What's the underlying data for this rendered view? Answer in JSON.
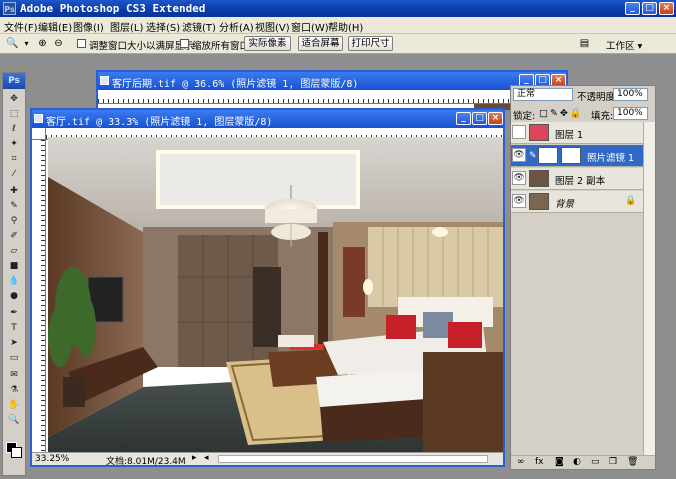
{
  "app": {
    "title": "Adobe Photoshop CS3 Extended",
    "logo": "Ps"
  },
  "menu": [
    "文件(F)",
    "编辑(E)",
    "图像(I)",
    "图层(L)",
    "选择(S)",
    "滤镜(T)",
    "分析(A)",
    "视图(V)",
    "窗口(W)",
    "帮助(H)"
  ],
  "options": {
    "resize_windows": "调整窗口大小以满屏显示",
    "zoom_all": "缩放所有窗口",
    "actual_pixels": "实际像素",
    "fit_screen": "适合屏幕",
    "print_size": "打印尺寸",
    "workspace": "工作区 ▾"
  },
  "documents": {
    "back": {
      "title": "客厅后期.tif @ 36.6% (照片滤镜 1, 图层蒙版/8)"
    },
    "front": {
      "title": "客厅.tif @ 33.3% (照片滤镜 1, 图层蒙版/8)",
      "zoom": "33.25%",
      "doc_info": "文档:8.01M/23.4M"
    }
  },
  "layers_panel": {
    "blend_mode": "正常",
    "opacity_label": "不透明度:",
    "opacity_value": "100%",
    "lock_label": "锁定:",
    "fill_label": "填充:",
    "fill_value": "100%",
    "layers": [
      {
        "name": "图层 1",
        "visible": false,
        "active": false,
        "thumb": "#e0445a"
      },
      {
        "name": "照片滤镜 1",
        "visible": true,
        "active": true,
        "thumb": "#ffffff"
      },
      {
        "name": "图层 2 副本",
        "visible": true,
        "active": false,
        "thumb": "#6b5542"
      },
      {
        "name": "背景",
        "visible": true,
        "active": false,
        "thumb": "#7a6550",
        "locked": true
      }
    ]
  },
  "colors": {
    "title_bar": "#0a3aa8",
    "panel_bg": "#d4d0c8",
    "selection": "#3169c6"
  }
}
